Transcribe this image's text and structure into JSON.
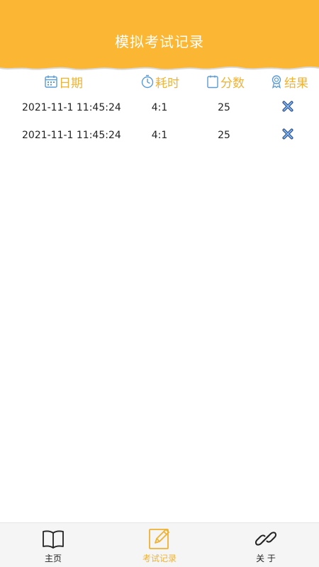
{
  "header": {
    "title": "模拟考试记录",
    "color": "#fbb633"
  },
  "columns": [
    {
      "label": "日期",
      "icon": "calendar-icon"
    },
    {
      "label": "耗时",
      "icon": "clock-icon"
    },
    {
      "label": "分数",
      "icon": "notepad-icon"
    },
    {
      "label": "结果",
      "icon": "medal-icon"
    }
  ],
  "records": [
    {
      "date": "2021-11-1 11:45:24",
      "time": "4:1",
      "score": "25",
      "result_icon": "fail-x-icon"
    },
    {
      "date": "2021-11-1 11:45:24",
      "time": "4:1",
      "score": "25",
      "result_icon": "fail-x-icon"
    }
  ],
  "tabbar": {
    "items": [
      {
        "label": "主页",
        "icon": "book-icon",
        "active": false
      },
      {
        "label": "考试记录",
        "icon": "pencil-note-icon",
        "active": true
      },
      {
        "label": "关 于",
        "icon": "link-icon",
        "active": false
      }
    ],
    "active_color": "#f0b232"
  }
}
